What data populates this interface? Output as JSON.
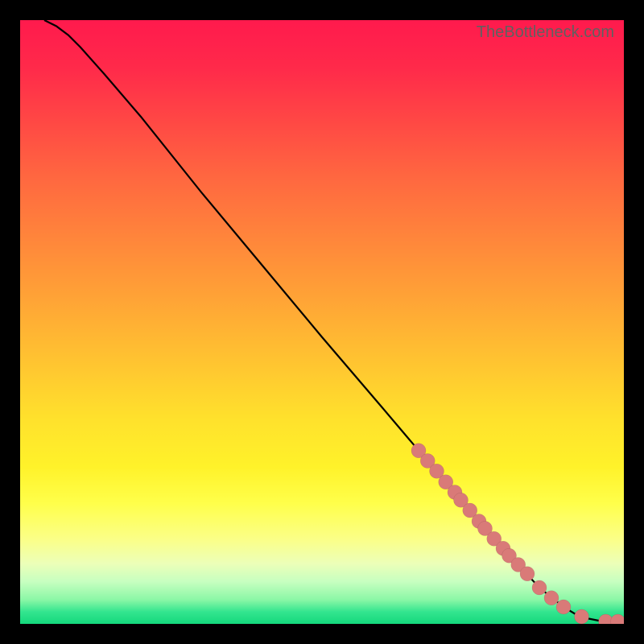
{
  "watermark": "TheBottleneck.com",
  "chart_data": {
    "type": "line",
    "title": "",
    "xlabel": "",
    "ylabel": "",
    "xlim": [
      0,
      100
    ],
    "ylim": [
      0,
      100
    ],
    "curve": {
      "x": [
        4,
        6,
        8,
        10,
        14,
        20,
        30,
        40,
        50,
        60,
        70,
        80,
        86,
        90,
        92,
        94,
        96,
        98,
        100
      ],
      "y": [
        100,
        99,
        97.5,
        95.5,
        91,
        84,
        71.5,
        59.5,
        47.5,
        35.8,
        24,
        12.5,
        6,
        2.8,
        1.6,
        0.9,
        0.5,
        0.4,
        0.4
      ]
    },
    "markers": {
      "x": [
        66,
        67.5,
        69,
        70.5,
        72,
        73,
        74.5,
        76,
        77,
        78.5,
        80,
        81,
        82.5,
        84,
        86,
        88,
        90,
        93,
        97,
        99
      ],
      "y": [
        28.7,
        27.0,
        25.3,
        23.5,
        21.8,
        20.5,
        18.8,
        17.0,
        15.8,
        14.1,
        12.5,
        11.3,
        9.8,
        8.3,
        6.0,
        4.3,
        2.8,
        1.2,
        0.4,
        0.4
      ]
    }
  }
}
